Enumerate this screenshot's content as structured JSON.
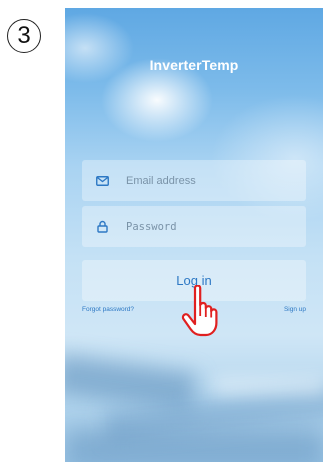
{
  "step": {
    "number": "3"
  },
  "app": {
    "title": "InverterTemp"
  },
  "form": {
    "email": {
      "placeholder": "Email address",
      "icon": "mail-icon"
    },
    "password": {
      "placeholder": "Password",
      "icon": "lock-icon"
    },
    "login_label": "Log in",
    "forgot_label": "Forgot password?",
    "signup_label": "Sign up"
  },
  "colors": {
    "accent": "#2d78c4",
    "pointer": "#e02020"
  },
  "annotation": {
    "icon": "pointing-hand-icon"
  }
}
